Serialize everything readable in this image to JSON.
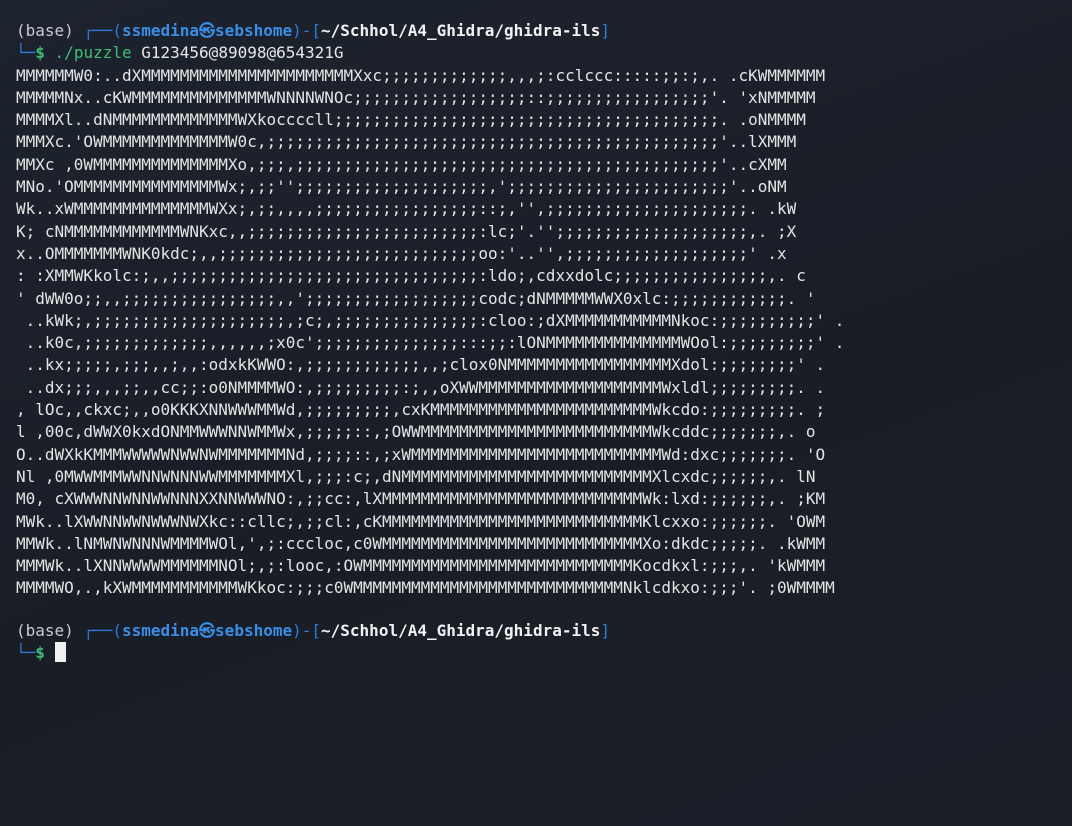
{
  "prompt_1": {
    "env": "(base)",
    "box_top": "┌──(",
    "user": "ssmedina",
    "at": "㉿",
    "host": "sebshome",
    "sep": ")-[",
    "path": "~/Schhol/A4_Ghidra/ghidra-ils",
    "close": "]",
    "box_bottom": "└─",
    "dollar": "$",
    "command": "./puzzle",
    "arguments": "G123456@89098@654321G"
  },
  "ascii_art": [
    "MMMMMMW0:..dXMMMMMMMMMMMMMMMMMMMMMMXxc;;;;;;;;;;;;;,,,;:cclccc:::::;;:;,. .cKWMMMMMM",
    "MMMMMNx..cKWMMMMMMMMMMMMMMWNNNNWNOc;;;;;;;;;;;;;;;;;;::;;;;;;;;;;;;;;;;;'. 'xNMMMMM",
    "MMMMXl..dNMMMMMMMMMMMMMWXkoccccll;;;;;;;;;;;;;;;;;;;;;;;;;;;;;;;;;;;;;;;;. .oNMMMM",
    "MMMXc.'OWMMMMMMMMMMMMMW0c,;;;;;;;;;;;;;;;;;;;;;;;;;;;;;;;;;;;;;;;;;;;;;;;'..lXMMM",
    "MMXc ,0WMMMMMMMMMMMMMMXo,;;;,;;;;;;;;;;;;;;;;;;;;;;;;;;;;;;;;;;;;;;;;;;;;'..cXMM",
    "MNo.'OMMMMMMMMMMMMMMMWx;,;;'';;;;;;;;;;;;;;;;;;;;,';;;;;;;;;;;;;;;;;;;;;;;'..oNM",
    "Wk..xWMMMMMMMMMMMMMMWXx;,;;,,,,;;;;;;;;;;;;;;;;;::;,'',;;;;;;;;;;;;;;;;;;;;;. .kW",
    "K; cNMMMMMMMMMMMMWNKxc,,;;;;;;;;;;;;;;;;;;;;;;;;:lc;'.'';;;;;;;;;;;;;;;;;;;;,. ;X",
    "x..OMMMMMMMWNK0kdc;,,;;;;;;;;;;;;;;;;;;;;;;;;;;;oo:'..'',;;;;;;;;;;;;;;;;;;;' .x",
    ": :XMMWKkolc:;,,;;;;;;;;;;;;;;;;;;;;;;;;;;;;;;;;:ldo;,cdxxdolc;;;;;;;;;;;;;;;;,. c",
    "' dWW0o;;,,;;;;;;;;;;;;;;;;,,';;;;;;;;;;;;;;;;;;codc;dNMMMMMWWX0xlc:;;;;;;;;;;;;. '",
    " ..kWk;,;;;;;;;;;;;;;;;;;;;;,;c;,;;;;;;;;;;;;;;;:cloo:;dXMMMMMMMMMMMNkoc:;;;;;;;;;;' .",
    " ..k0c,;;;;;;;;;;;;;,,,,,,;x0c';;;;;;;;;;;;;;;:::;;:lONMMMMMMMMMMMMMMWOol:;;;;;;;;;' .",
    " ..kx;;;;;,;;;,,;,,:odxkKWWO:,;;;;;;;;;;;;,,;clox0NMMMMMMMMMMMMMMMMMXdol:;;;;;;;;' .",
    " ..dx;;;,,,;;,,cc;;:o0NMMMMWO:,;;;;;;;;;:;,,oXWWMMMMMMMMMMMMMMMMMMMWxldl;;;;;;;;;. .",
    ", lOc,,ckxc;,,o0KKKXNNWWWMMWd,;;;;;;;;;,cxKMMMMMMMMMMMMMMMMMMMMMMMWkcdo:;;;;;;;;;. ;",
    "l ,00c,dWWX0kxdONMMWWWNNWMMWx,;;;;;::,;OWWMMMMMMMMMMMMMMMMMMMMMMMMWkcddc;;;;;;;,. o",
    "O..dWXkKMMMWWWWWNWWNWMMMMMMMNd,;;;;::,;xWMMMMMMMMMMMMMMMMMMMMMMMMMMWd:dxc;;;;;;;. 'O",
    "Nl ,0MWWMMMWWNNWNNNWWMMMMMMMXl,;;;:c;,dNMMMMMMMMMMMMMMMMMMMMMMMMMMXlcxdc;;;;;;,. lN",
    "M0, cXWWWNNWNNWWNNNXXNNWWWNO:,;;cc:,lXMMMMMMMMMMMMMMMMMMMMMMMMMMMWk:lxd:;;;;;;,. ;KM",
    "MWk..lXWWNNWWNWWWNWXkc::cllc;,;;cl:,cKMMMMMMMMMMMMMMMMMMMMMMMMMMMKlcxxo:;;;;;;. 'OWM",
    "MMWk..lNMWNWNNNWMMMMWOl,',;:cccloc,c0WMMMMMMMMMMMMMMMMMMMMMMMMMMMXo:dkdc;;;;;. .kWMM",
    "MMMWk..lXNNWWWWMMMMMMNOl;,;:looc,:OWMMMMMMMMMMMMMMMMMMMMMMMMMMMMKocdkxl:;;;,. 'kWMMM",
    "MMMMWO,.,kXWMMMMMMMMMMMWKkoc:;;;c0WMMMMMMMMMMMMMMMMMMMMMMMMMMMMNklcdkxo:;;;'. ;0WMMMM"
  ],
  "prompt_2": {
    "env": "(base)",
    "box_top": "┌──(",
    "user": "ssmedina",
    "at": "㉿",
    "host": "sebshome",
    "sep": ")-[",
    "path": "~/Schhol/A4_Ghidra/ghidra-ils",
    "close": "]",
    "box_bottom": "└─",
    "dollar": "$"
  },
  "colors": {
    "background": "#1b2029",
    "prompt_box": "#2f7bd8",
    "user_host": "#3a8ee6",
    "command": "#3fbf73",
    "text": "#e6e6e6"
  }
}
